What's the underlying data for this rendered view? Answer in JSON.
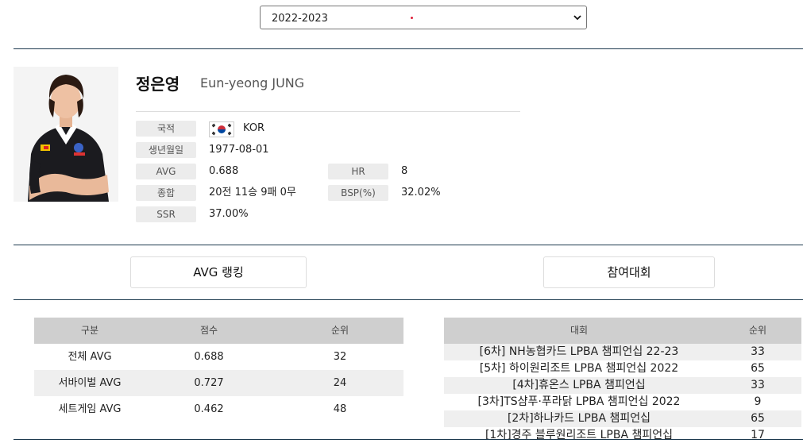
{
  "season": {
    "selected": "2022-2023"
  },
  "player": {
    "name_ko": "정은영",
    "name_en": "Eun-yeong JUNG",
    "fields": {
      "nationality": {
        "label": "국적",
        "value": "KOR"
      },
      "birth": {
        "label": "생년월일",
        "value": "1977-08-01"
      },
      "avg": {
        "label": "AVG",
        "value": "0.688"
      },
      "hr": {
        "label": "HR",
        "value": "8"
      },
      "record": {
        "label": "종합",
        "value": "20전 11승 9패 0무"
      },
      "bsp": {
        "label": "BSP(%)",
        "value": "32.02%"
      },
      "ssr": {
        "label": "SSR",
        "value": "37.00%"
      }
    }
  },
  "sections": {
    "avg_ranking": "AVG 랭킹",
    "tournaments": "참여대회"
  },
  "avg_table": {
    "headers": [
      "구분",
      "점수",
      "순위"
    ],
    "rows": [
      {
        "category": "전체 AVG",
        "score": "0.688",
        "rank": "32"
      },
      {
        "category": "서바이벌 AVG",
        "score": "0.727",
        "rank": "24"
      },
      {
        "category": "세트게임 AVG",
        "score": "0.462",
        "rank": "48"
      }
    ]
  },
  "tournament_table": {
    "headers": [
      "대회",
      "순위"
    ],
    "rows": [
      {
        "name": "[6차] NH농협카드 LPBA 챔피언십 22-23",
        "rank": "33"
      },
      {
        "name": "[5차] 하이원리조트 LPBA 챔피언십 2022",
        "rank": "65"
      },
      {
        "name": "[4차]휴온스 LPBA 챔피언십",
        "rank": "33"
      },
      {
        "name": "[3차]TS샴푸·푸라닭 LPBA 챔피언십 2022",
        "rank": "9"
      },
      {
        "name": "[2차]하나카드 LPBA 챔피언십",
        "rank": "65"
      },
      {
        "name": "[1차]경주 블루원리조트 LPBA 챔피언십",
        "rank": "17"
      }
    ]
  },
  "colors": {
    "divider": "#1d3a4f",
    "header_bg": "#cfcfcf",
    "label_bg": "#ececec",
    "row_alt": "#efefef"
  }
}
